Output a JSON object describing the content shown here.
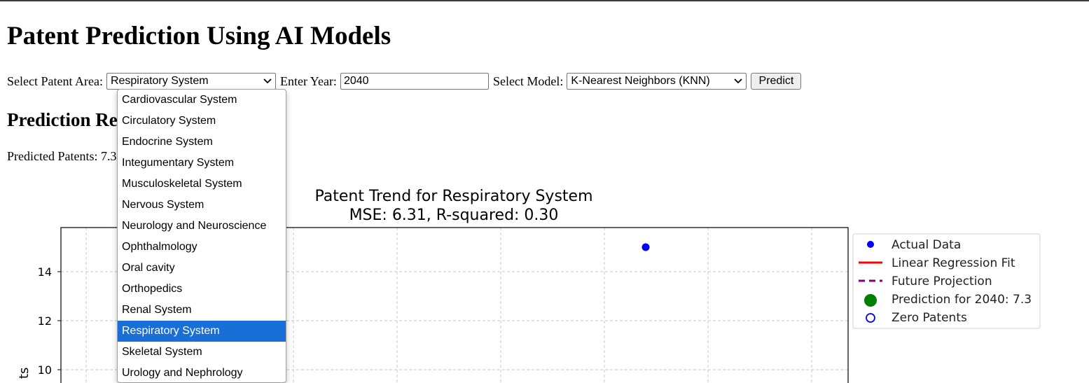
{
  "page": {
    "title": "Patent Prediction Using AI Models",
    "results_heading": "Prediction Results",
    "predicted_label": "Predicted Patents: 7.3"
  },
  "form": {
    "area_label": "Select Patent Area:",
    "area_value": "Respiratory System",
    "year_label": "Enter Year:",
    "year_value": "2040",
    "model_label": "Select Model:",
    "model_value": "K-Nearest Neighbors (KNN)",
    "predict_label": "Predict"
  },
  "dropdown": {
    "options": [
      "Cardiovascular System",
      "Circulatory System",
      "Endocrine System",
      "Integumentary System",
      "Musculoskeletal System",
      "Nervous System",
      "Neurology and Neuroscience",
      "Ophthalmology",
      "Oral cavity",
      "Orthopedics",
      "Renal System",
      "Respiratory System",
      "Skeletal System",
      "Urology and Nephrology"
    ],
    "selected_index": 11
  },
  "chart_data": {
    "type": "scatter",
    "title": "Patent Trend for Respiratory System",
    "subtitle": "MSE: 6.31, R-squared: 0.30",
    "ylabel_visible_fragment": "ts",
    "yticks": [
      10,
      12,
      14
    ],
    "grid": true,
    "legend_placement": "right-outside",
    "legend": [
      {
        "label": "Actual Data",
        "marker": "dot",
        "color": "#0000ff"
      },
      {
        "label": "Linear Regression Fit",
        "marker": "line",
        "color": "#ff0000"
      },
      {
        "label": "Future Projection",
        "marker": "dashed",
        "color": "#800080"
      },
      {
        "label": "Prediction for 2040: 7.3",
        "marker": "big-dot",
        "color": "#008000"
      },
      {
        "label": "Zero Patents",
        "marker": "hollow",
        "color": "#0000ff"
      }
    ],
    "visible_points": [
      {
        "series": "Actual Data",
        "y": 15.0
      }
    ]
  }
}
